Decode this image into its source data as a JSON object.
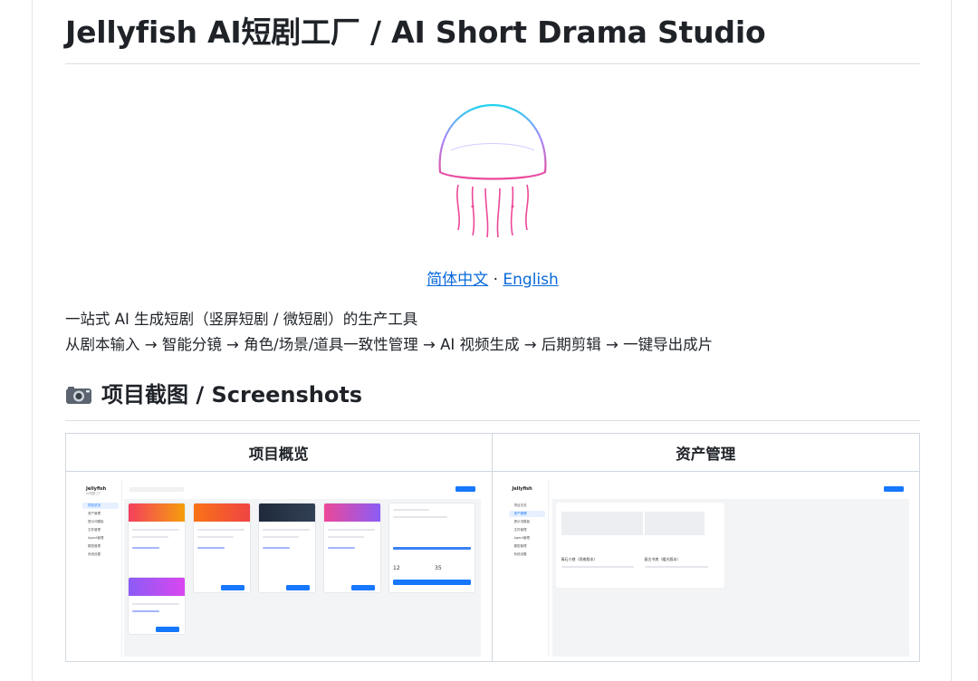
{
  "title": "Jellyfish AI短剧工厂 / AI Short Drama Studio",
  "languages": {
    "zh": "简体中文",
    "separator": "·",
    "en": "English"
  },
  "description": {
    "line1": "一站式 AI 生成短剧（竖屏短剧 / 微短剧）的生产工具",
    "line2": "从剧本输入 → 智能分镜 → 角色/场景/道具一致性管理 → AI 视频生成 → 后期剪辑 → 一键导出成片"
  },
  "screenshots_heading": "项目截图 / Screenshots",
  "icons": {
    "camera": "camera-icon",
    "logo": "jellyfish-logo"
  },
  "colors": {
    "link": "#0969da",
    "accent": "#1677ff",
    "logo_top": "#22d3ee",
    "logo_bottom": "#ec4899"
  },
  "table": {
    "headers": [
      "项目概览",
      "资产管理"
    ],
    "overview_mock": {
      "brand": "Jellyfish",
      "brand_sub": "AI短剧工厂",
      "nav": [
        "项目总览",
        "资产管理",
        "提示词模板",
        "文件管理",
        "Agent管理",
        "模型管理",
        "系统设置"
      ],
      "toolbar_stat_a": "12",
      "toolbar_stat_b": "35"
    },
    "assets_mock": {
      "brand": "Jellyfish",
      "nav": [
        "项目总览",
        "资产管理",
        "提示词模板",
        "文件管理",
        "Agent管理",
        "模型管理",
        "系统设置"
      ],
      "card_a": "青石小巷（雨夜版本）",
      "card_b": "复古书房（暖光版本）"
    }
  }
}
